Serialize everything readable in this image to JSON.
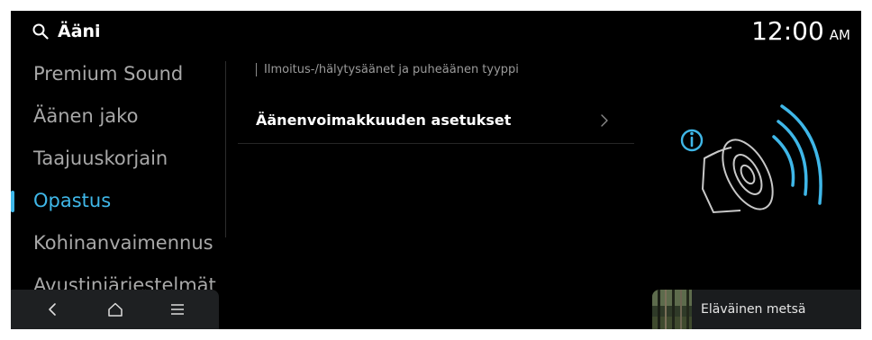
{
  "header": {
    "title": "Ääni",
    "search_icon": "search-icon"
  },
  "clock": {
    "time": "12:00",
    "ampm": "AM"
  },
  "sidebar": {
    "items": [
      {
        "label": "Premium Sound",
        "active": false
      },
      {
        "label": "Äänen jako",
        "active": false
      },
      {
        "label": "Taajuuskorjain",
        "active": false
      },
      {
        "label": "Opastus",
        "active": true
      },
      {
        "label": "Kohinanvaimennus",
        "active": false
      },
      {
        "label": "Avustinjärjestelmät",
        "active": false
      }
    ]
  },
  "nav": {
    "back_icon": "chevron-left-icon",
    "home_icon": "home-icon",
    "menu_icon": "menu-icon"
  },
  "main": {
    "section_title": "Ilmoitus-/hälytysäänet ja puheäänen tyyppi",
    "rows": [
      {
        "label": "Äänenvoimakkuuden asetukset"
      }
    ]
  },
  "media": {
    "title": "Eläväinen metsä",
    "thumb_icon": "forest-thumbnail"
  },
  "colors": {
    "accent": "#3fb7e8",
    "background": "#000000",
    "inactive_text": "#a8a8a8"
  },
  "illustration": {
    "icons": [
      "info-icon",
      "speaker-icon",
      "sound-waves-icon"
    ]
  }
}
